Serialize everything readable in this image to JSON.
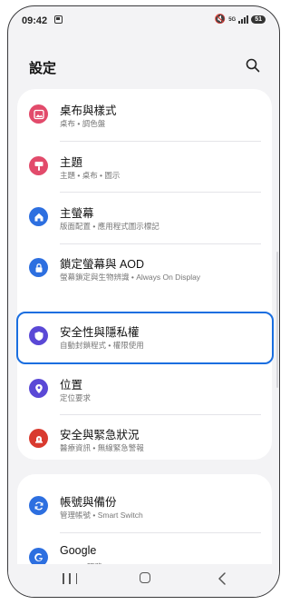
{
  "status_bar": {
    "time": "09:42",
    "network": "5G",
    "battery": "51"
  },
  "header": {
    "title": "設定"
  },
  "settings": [
    {
      "title": "桌布與樣式",
      "subtitle": "桌布 • 調色盤",
      "icon": "wallpaper-icon",
      "color": "#e24b6b"
    },
    {
      "title": "主題",
      "subtitle": "主題 • 桌布 • 圖示",
      "icon": "theme-brush-icon",
      "color": "#e24b6b"
    },
    {
      "title": "主螢幕",
      "subtitle": "版面配置 • 應用程式圖示標記",
      "icon": "home-icon",
      "color": "#2d6fe0"
    },
    {
      "title": "鎖定螢幕與 AOD",
      "subtitle": "螢幕鎖定與生物辨識 • Always On Display",
      "icon": "lock-icon",
      "color": "#2d6fe0"
    },
    {
      "title": "安全性與隱私權",
      "subtitle": "自動封鎖程式 • 權限使用",
      "icon": "shield-icon",
      "color": "#5a48d6"
    },
    {
      "title": "位置",
      "subtitle": "定位要求",
      "icon": "location-icon",
      "color": "#5a48d6"
    },
    {
      "title": "安全與緊急狀況",
      "subtitle": "醫療資訊 • 無線緊急警報",
      "icon": "emergency-icon",
      "color": "#d93a2f"
    },
    {
      "title": "帳號與備份",
      "subtitle": "管理帳號 • Smart Switch",
      "icon": "sync-icon",
      "color": "#2d6fe0"
    },
    {
      "title": "Google",
      "subtitle": "Google 服務",
      "icon": "google-icon",
      "color": "#2d6fe0"
    }
  ],
  "highlight_color": "#1a6ee0"
}
